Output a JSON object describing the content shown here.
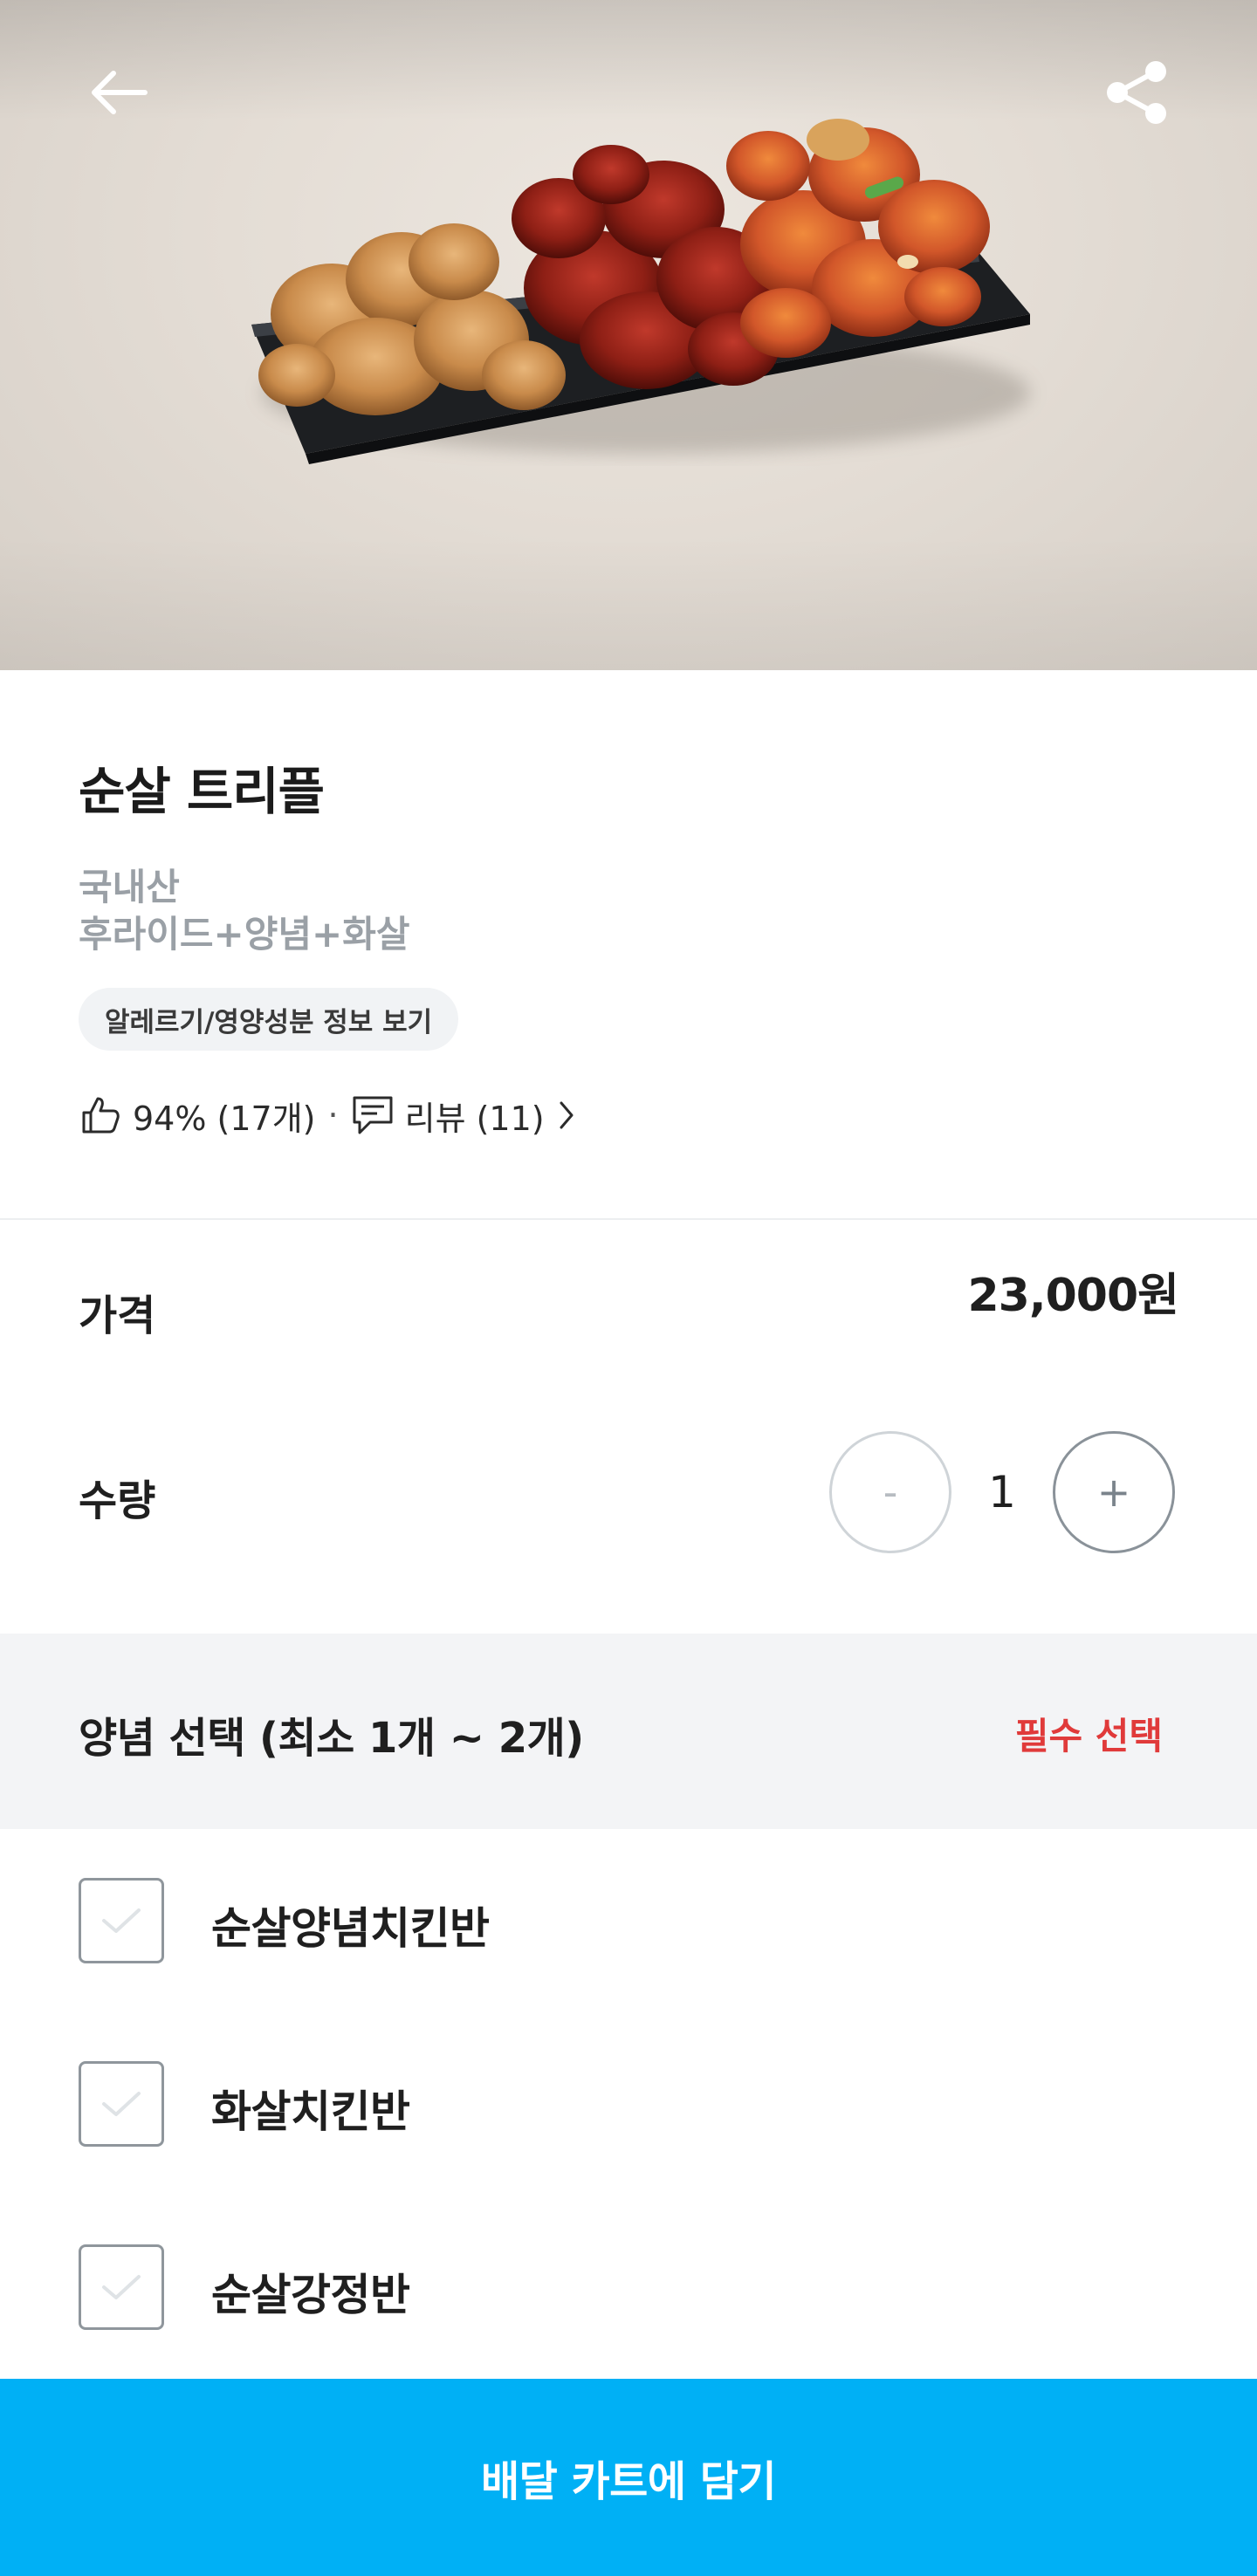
{
  "header": {
    "back_icon": "arrow-left-icon",
    "share_icon": "share-icon"
  },
  "product": {
    "name": "순살 트리플",
    "origin": "국내산",
    "composition": "후라이드+양념+화살",
    "allergy_chip": "알레르기/영양성분 정보 보기",
    "rating_text": "94% (17개)",
    "separator": "·",
    "review_text": "리뷰 (11)"
  },
  "price": {
    "label": "가격",
    "value": "23,000원"
  },
  "quantity": {
    "label": "수량",
    "minus": "-",
    "value": "1",
    "plus": "+"
  },
  "sauce_section": {
    "title": "양념 선택 (최소 1개 ~ 2개)",
    "required_label": "필수 선택",
    "options": [
      {
        "label": "순살양념치킨반",
        "checked": false
      },
      {
        "label": "화살치킨반",
        "checked": false
      },
      {
        "label": "순살강정반",
        "checked": false
      }
    ]
  },
  "cta": {
    "label": "배달 카트에 담기"
  },
  "colors": {
    "accent": "#00b0f5",
    "required": "#e03a3a",
    "muted_text": "#9aa0a6",
    "section_bg": "#f3f4f6"
  }
}
